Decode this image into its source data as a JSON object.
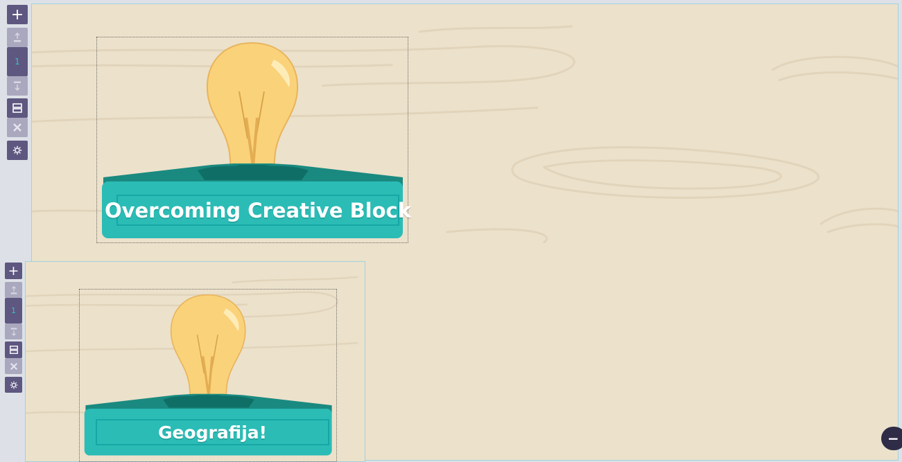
{
  "colors": {
    "canvas_bg": "#ece1cb",
    "toolbar_button": "#5e5780",
    "toolbar_button_disabled": "#aaa8be",
    "banner_teal": "#2bbcb6",
    "banner_dark_teal": "#1a8a80",
    "bulb_yellow": "#fad27a",
    "app_bg": "#dde1e7"
  },
  "toolbar_icons": {
    "add": "plus-icon",
    "move_up": "move-page-up-icon",
    "move_down": "move-page-down-icon",
    "layout": "layout-icon",
    "delete": "delete-x-icon",
    "settings": "gear-icon"
  },
  "pages": [
    {
      "page_number": "1",
      "title": "Overcoming Creative Block"
    },
    {
      "page_number": "1",
      "title": "Geografija!"
    }
  ],
  "zoom": {
    "label": "−"
  }
}
